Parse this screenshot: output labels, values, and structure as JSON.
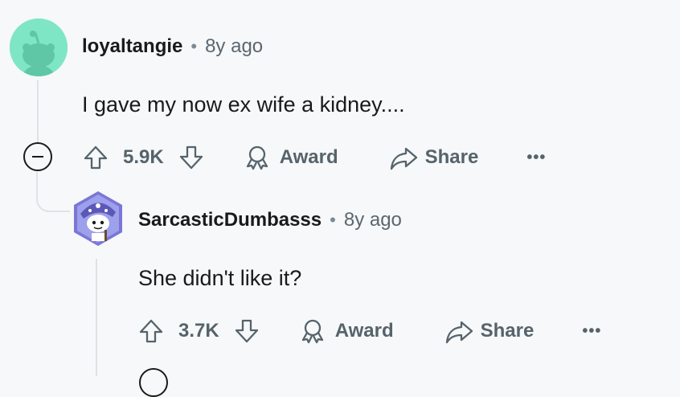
{
  "comments": [
    {
      "username": "loyaltangie",
      "time": "8y ago",
      "separator": "•",
      "body": "I gave my now ex wife a kidney....",
      "votes": "5.9K",
      "award_label": "Award",
      "share_label": "Share",
      "more_label": "•••"
    },
    {
      "username": "SarcasticDumbasss",
      "time": "8y ago",
      "separator": "•",
      "body": "She didn't like it?",
      "votes": "3.7K",
      "award_label": "Award",
      "share_label": "Share",
      "more_label": "•••"
    }
  ],
  "colors": {
    "background": "#f6f8f9",
    "avatar1": "#7ee6c5",
    "avatar2": "#7b76d6",
    "meta_text": "#56636b"
  }
}
